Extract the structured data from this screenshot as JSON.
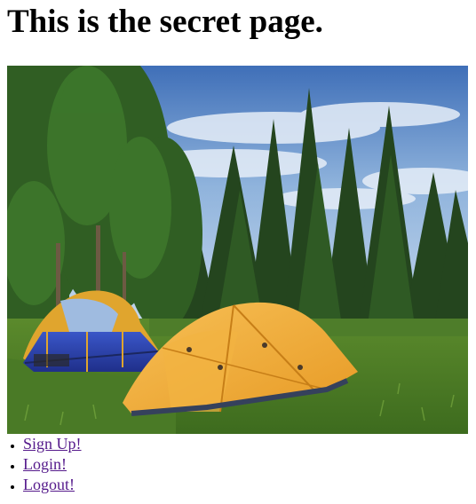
{
  "page": {
    "heading": "This is the secret page."
  },
  "photo": {
    "subject": "camping-tents-forest-image"
  },
  "nav": {
    "links": [
      {
        "label": "Sign Up!"
      },
      {
        "label": "Login!"
      },
      {
        "label": "Logout!"
      }
    ]
  },
  "colors": {
    "visited_link": "#551a8b",
    "background": "#ffffff"
  }
}
